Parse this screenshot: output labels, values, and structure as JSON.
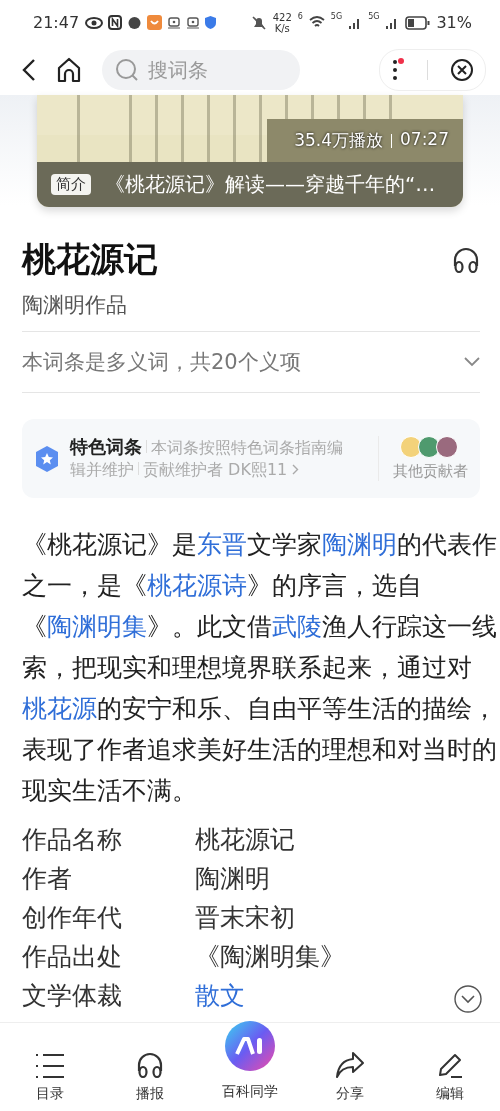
{
  "status_bar": {
    "time": "21:47",
    "speed_value": "422",
    "speed_unit": "K/s",
    "wifi_tag": "6",
    "sim1_tag": "5G",
    "sim2_tag": "5G",
    "battery": "31%"
  },
  "nav": {
    "search_placeholder": "搜词条",
    "menu_badge": true
  },
  "video": {
    "kind": "picture",
    "plays": "35.4万播放",
    "duration": "07:27",
    "tag": "简介",
    "caption": "《桃花源记》解读——穿越千年的“…"
  },
  "title": "桃花源记",
  "subtitle": "陶渊明作品",
  "polysemy": "本词条是多义词，共20个义项",
  "feature": {
    "label": "特色词条",
    "desc_1": "本词条按照特色词条指南编",
    "desc_2": "辑并维护",
    "contributor": "贡献维护者 DK熙11",
    "others": "其他贡献者"
  },
  "intro": [
    {
      "text": "《桃花源记》是",
      "link": false
    },
    {
      "text": "东晋",
      "link": true
    },
    {
      "text": "文学家",
      "link": false
    },
    {
      "text": "陶渊明",
      "link": true
    },
    {
      "text": "的代表作之一，是《",
      "link": false
    },
    {
      "text": "桃花源诗",
      "link": true
    },
    {
      "text": "》的序言，选自《",
      "link": false
    },
    {
      "text": "陶渊明集",
      "link": true
    },
    {
      "text": "》。此文借",
      "link": false
    },
    {
      "text": "武陵",
      "link": true
    },
    {
      "text": "渔人行踪这一线索，把现实和理想境界联系起来，通过对",
      "link": false
    },
    {
      "text": "桃花源",
      "link": true
    },
    {
      "text": "的安宁和乐、自由平等生活的描绘，表现了作者追求美好生活的理想和对当时的现实生活不满。",
      "link": false
    }
  ],
  "info": [
    {
      "label": "作品名称",
      "value": "桃花源记",
      "link": false
    },
    {
      "label": "作者",
      "value": "陶渊明",
      "link": false
    },
    {
      "label": "创作年代",
      "value": "晋末宋初",
      "link": false
    },
    {
      "label": "作品出处",
      "value": "《陶渊明集》",
      "link": false
    },
    {
      "label": "文学体裁",
      "value": "散文",
      "link": true
    }
  ],
  "tabbar": [
    {
      "label": "目录",
      "kind": "list"
    },
    {
      "label": "播报",
      "kind": "headphones"
    },
    {
      "label": "百科同学",
      "kind": "ai"
    },
    {
      "label": "分享",
      "kind": "share"
    },
    {
      "label": "编辑",
      "kind": "edit"
    }
  ]
}
